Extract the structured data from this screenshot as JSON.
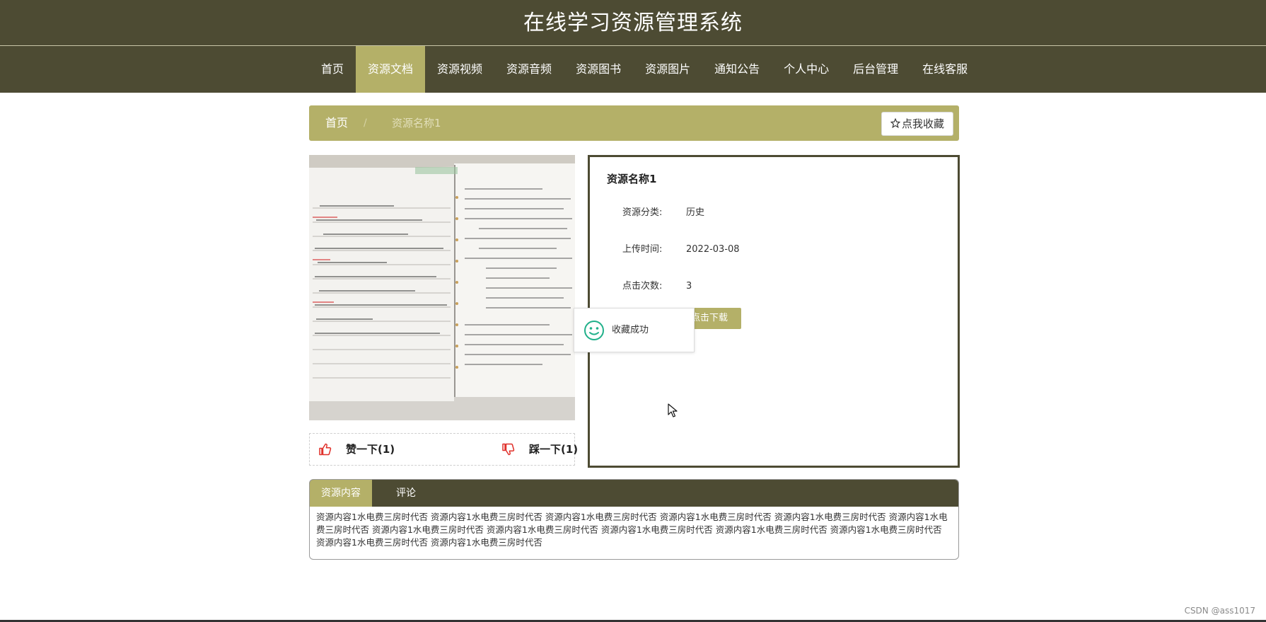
{
  "site": {
    "title": "在线学习资源管理系统"
  },
  "nav": {
    "items": [
      {
        "label": "首页"
      },
      {
        "label": "资源文档",
        "active": true
      },
      {
        "label": "资源视频"
      },
      {
        "label": "资源音频"
      },
      {
        "label": "资源图书"
      },
      {
        "label": "资源图片"
      },
      {
        "label": "通知公告"
      },
      {
        "label": "个人中心"
      },
      {
        "label": "后台管理"
      },
      {
        "label": "在线客服"
      }
    ]
  },
  "breadcrumb": {
    "home": "首页",
    "separator": "/",
    "current": "资源名称1"
  },
  "favorite_button": {
    "icon": "star-outline-icon",
    "label": "点我收藏"
  },
  "resource": {
    "name": "资源名称1",
    "fields": [
      {
        "key": "资源分类:",
        "value": "历史"
      },
      {
        "key": "上传时间:",
        "value": "2022-03-08"
      },
      {
        "key": "点击次数:",
        "value": "3"
      }
    ],
    "download_label": "点击下载"
  },
  "votes": {
    "like_label": "赞一下(1)",
    "dislike_label": "踩一下(1)"
  },
  "toast": {
    "icon": "smile-icon",
    "message": "收藏成功"
  },
  "tabs": {
    "items": [
      {
        "label": "资源内容",
        "active": true
      },
      {
        "label": "评论"
      }
    ],
    "content": "资源内容1水电费三房时代否 资源内容1水电费三房时代否 资源内容1水电费三房时代否 资源内容1水电费三房时代否 资源内容1水电费三房时代否 资源内容1水电费三房时代否 资源内容1水电费三房时代否 资源内容1水电费三房时代否 资源内容1水电费三房时代否 资源内容1水电费三房时代否 资源内容1水电费三房时代否 资源内容1水电费三房时代否 资源内容1水电费三房时代否"
  },
  "footer": {
    "credit": "CSDN @ass1017"
  },
  "colors": {
    "header": "#4d4b33",
    "accent": "#b4b068",
    "icon_red": "#e0302a",
    "toast_green": "#21b08a"
  }
}
